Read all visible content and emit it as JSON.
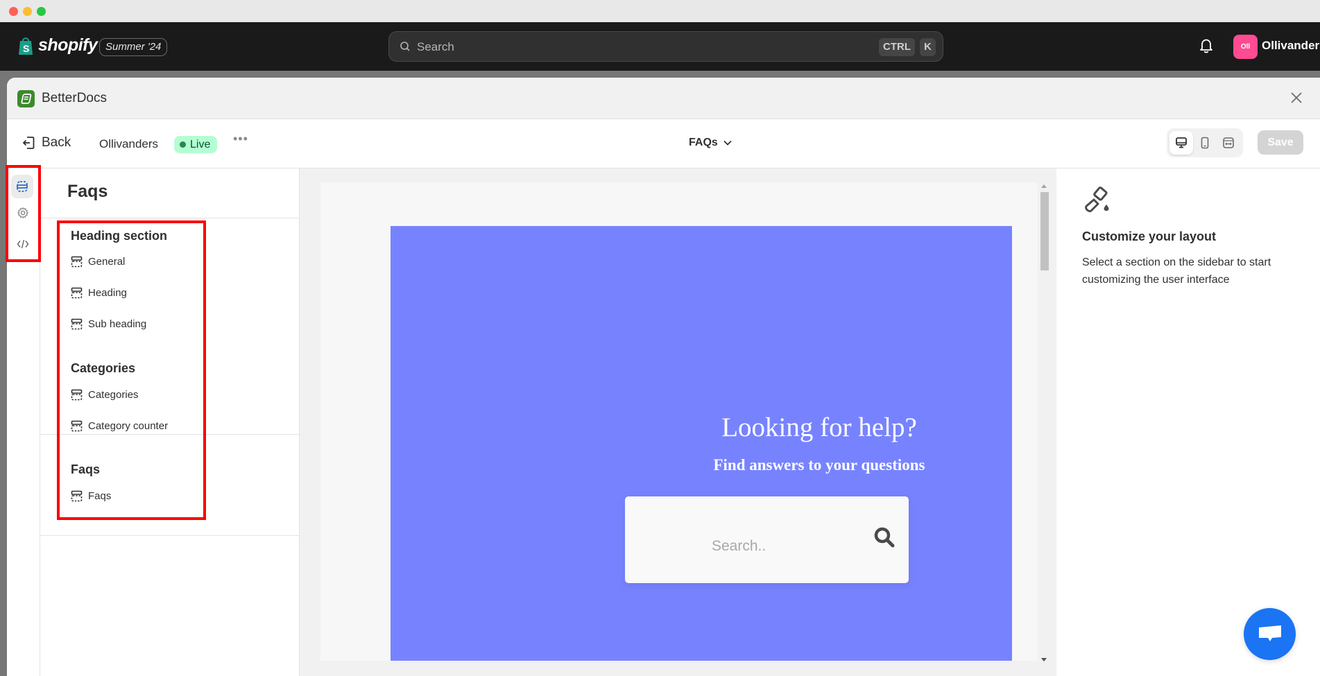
{
  "window": {
    "controls": [
      "close",
      "minimize",
      "zoom"
    ]
  },
  "topbar": {
    "brand": "shopify",
    "edition_badge": "Summer '24",
    "search": {
      "placeholder": "Search",
      "shortcut_keys": [
        "CTRL",
        "K"
      ]
    },
    "notifications_icon": "bell-icon",
    "account": {
      "avatar_initials": "Oll",
      "avatar_color": "#fe4b92",
      "store_name": "Ollivanders"
    }
  },
  "modal": {
    "app_name": "BetterDocs",
    "app_logo_color": "#3d8a2e",
    "close_icon": "close-icon"
  },
  "toolbar": {
    "back_label": "Back",
    "store_label": "Ollivanders",
    "status_badge": "Live",
    "status_color": "#b4fed2",
    "more_label": "•••",
    "page_selector": "FAQs",
    "device_modes": [
      {
        "name": "desktop",
        "icon": "desktop-icon",
        "active": true
      },
      {
        "name": "mobile",
        "icon": "mobile-icon",
        "active": false
      },
      {
        "name": "full-width",
        "icon": "full-width-icon",
        "active": false
      }
    ],
    "save_label": "Save",
    "save_disabled": true
  },
  "rail": {
    "items": [
      {
        "name": "sections",
        "icon": "sections-icon",
        "active": true
      },
      {
        "name": "settings",
        "icon": "gear-icon",
        "active": false
      },
      {
        "name": "custom-code",
        "icon": "code-icon",
        "active": false
      }
    ]
  },
  "side_panel": {
    "title": "Faqs",
    "groups": [
      {
        "title": "Heading section",
        "items": [
          "General",
          "Heading",
          "Sub heading"
        ]
      },
      {
        "title": "Categories",
        "items": [
          "Categories",
          "Category counter"
        ]
      },
      {
        "title": "Faqs",
        "items": [
          "Faqs"
        ]
      }
    ]
  },
  "preview": {
    "hero_color": "#7783fe",
    "title": "Looking for help?",
    "subtitle": "Find answers to your questions",
    "search_placeholder": "Search.."
  },
  "right_panel": {
    "icon": "paint-brush-icon",
    "title": "Customize your layout",
    "description": "Select a section on the sidebar to start customizing the user interface"
  },
  "chat_button": {
    "icon": "chat-icon",
    "color": "#1b74f3"
  },
  "annotations": {
    "highlight_color": "#fb0007"
  }
}
